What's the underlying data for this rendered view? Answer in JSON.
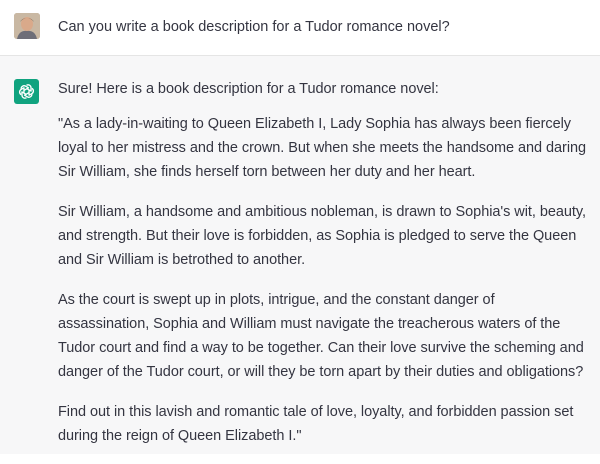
{
  "user_message": {
    "text": "Can you write a book description for a Tudor romance novel?"
  },
  "assistant_message": {
    "paragraphs": [
      "Sure! Here is a book description for a Tudor romance novel:",
      "\"As a lady-in-waiting to Queen Elizabeth I, Lady Sophia has always been fiercely loyal to her mistress and the crown. But when she meets the handsome and daring Sir William, she finds herself torn between her duty and her heart.",
      "Sir William, a handsome and ambitious nobleman, is drawn to Sophia's wit, beauty, and strength. But their love is forbidden, as Sophia is pledged to serve the Queen and Sir William is betrothed to another.",
      "As the court is swept up in plots, intrigue, and the constant danger of assassination, Sophia and William must navigate the treacherous waters of the Tudor court and find a way to be together. Can their love survive the scheming and danger of the Tudor court, or will they be torn apart by their duties and obligations?",
      "Find out in this lavish and romantic tale of love, loyalty, and forbidden passion set during the reign of Queen Elizabeth I.\""
    ]
  },
  "colors": {
    "assistant_bg": "#f7f7f8",
    "brand_green": "#10a37f",
    "text": "#343541"
  },
  "icons": {
    "user_avatar": "user-photo",
    "assistant_avatar": "openai-logo-icon"
  }
}
